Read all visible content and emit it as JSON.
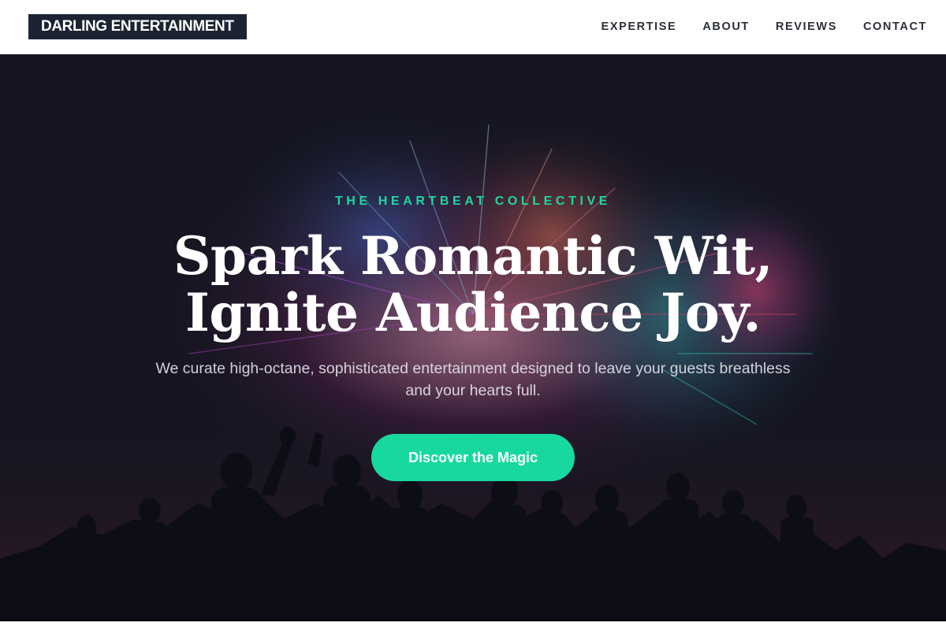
{
  "header": {
    "brand": "DARLING ENTERTAINMENT",
    "nav": [
      "EXPERTISE",
      "ABOUT",
      "REVIEWS",
      "CONTACT"
    ]
  },
  "hero": {
    "eyebrow": "THE HEARTBEAT COLLECTIVE",
    "headline_line1": "Spark Romantic Wit,",
    "headline_line2": "Ignite Audience Joy.",
    "subtitle": "We curate high-octane, sophisticated entertainment designed to leave your guests breathless and your hearts full.",
    "cta_label": "Discover the Magic",
    "background_image": "fireworks-crowd-silhouette"
  },
  "colors": {
    "brand_bg": "#1c2333",
    "accent": "#17d9a0",
    "hero_bg": "#171824",
    "nav_text": "#2b2f3a"
  }
}
